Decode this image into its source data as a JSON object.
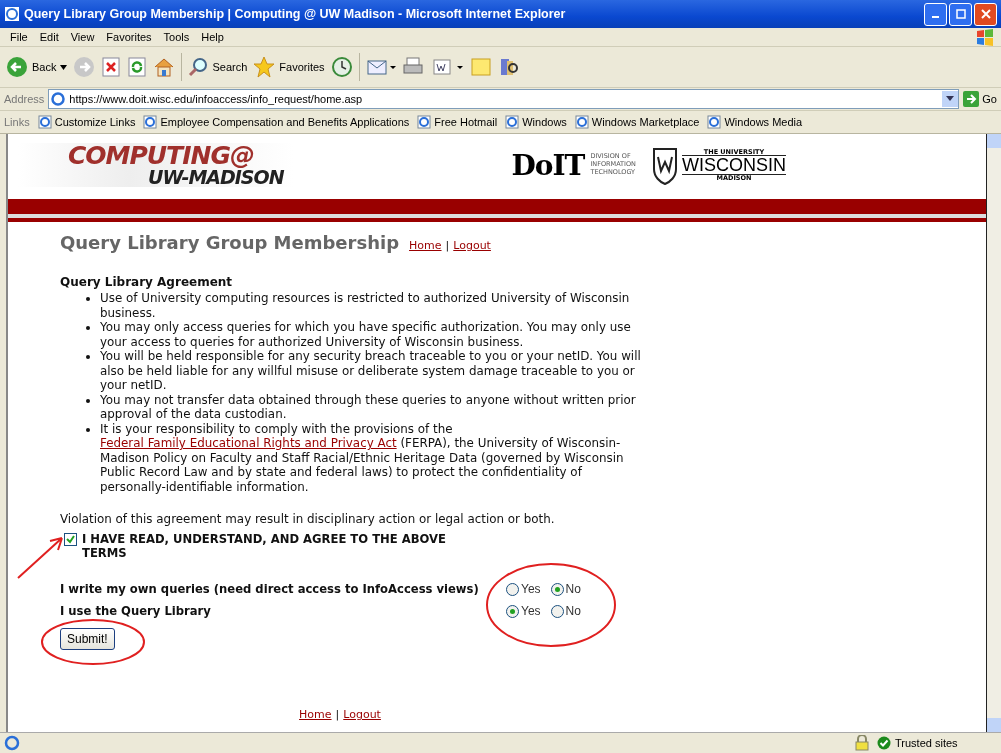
{
  "window": {
    "title": "Query Library Group Membership | Computing @ UW Madison - Microsoft Internet Explorer"
  },
  "menu": [
    "File",
    "Edit",
    "View",
    "Favorites",
    "Tools",
    "Help"
  ],
  "toolbar": {
    "back": "Back",
    "search": "Search",
    "favorites": "Favorites"
  },
  "address": {
    "label": "Address",
    "value": "https://www.doit.wisc.edu/infoaccess/info_request/home.asp",
    "go": "Go"
  },
  "links": {
    "label": "Links",
    "items": [
      "Customize Links",
      "Employee Compensation and Benefits Applications",
      "Free Hotmail",
      "Windows",
      "Windows Marketplace",
      "Windows Media"
    ]
  },
  "header": {
    "logo_top": "COMPUTING@",
    "logo_bottom": "UW-MADISON",
    "doit": "DoIT",
    "doit_sub": [
      "DIVISION OF",
      "INFORMATION",
      "TECHNOLOGY"
    ],
    "uw_top": "THE UNIVERSITY",
    "uw_main": "WISCONSIN",
    "uw_bottom": "MADISON"
  },
  "page": {
    "title": "Query Library Group Membership",
    "nav": [
      "Home",
      "Logout"
    ],
    "separator": "|"
  },
  "agreement": {
    "heading": "Query Library Agreement",
    "items": [
      {
        "text": "Use of University computing resources is restricted to authorized University of Wisconsin business."
      },
      {
        "text": "You may only access queries for which you have specific authorization. You may only use your access to queries for authorized University of Wisconsin business."
      },
      {
        "text": "You will be held responsible for any security breach traceable to you or your netID. You will also be held liable for any willful misuse or deliberate system damage traceable to you or your netID."
      },
      {
        "text": "You may not transfer data obtained through these queries to anyone without written prior approval of the data custodian."
      },
      {
        "text": "It is your responsibility to comply with the provisions of the ",
        "link": "Federal Family Educational Rights and Privacy Act",
        "after": " (FERPA), the University of Wisconsin-Madison Policy on Faculty and Staff Racial/Ethnic Heritage Data (governed by Wisconsin Public Record Law and by state and federal laws) to protect the confidentiality of personally-identifiable information."
      }
    ],
    "warning": "Violation of this agreement may result in disciplinary action or legal action or both.",
    "agree": {
      "label": "I HAVE READ, UNDERSTAND, AND AGREE TO THE ABOVE TERMS",
      "checked": true
    }
  },
  "questions": [
    {
      "label": "I write my own queries (need direct access to InfoAccess views)",
      "options": [
        {
          "label": "Yes",
          "selected": false
        },
        {
          "label": "No",
          "selected": true
        }
      ]
    },
    {
      "label": "I use the Query Library",
      "options": [
        {
          "label": "Yes",
          "selected": true
        },
        {
          "label": "No",
          "selected": false
        }
      ]
    }
  ],
  "submit": "Submit!",
  "footer_nav": [
    "Home",
    "Logout"
  ],
  "footer_separator": "|",
  "status_bar": {
    "zone": "Trusted sites"
  }
}
